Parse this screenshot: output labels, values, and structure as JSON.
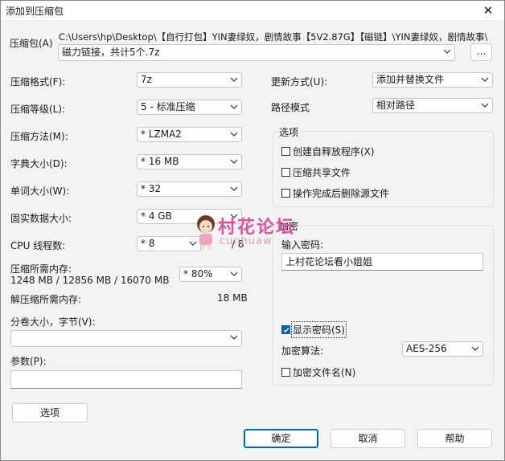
{
  "window": {
    "title": "添加到压缩包",
    "close": "✕"
  },
  "archive": {
    "label": "压缩包(A)",
    "path_line1": "C:\\Users\\hp\\Desktop\\【自行打包】YIN妻绿奴，剧情故事【5V2.87G】【磁链】\\YIN妻绿奴，剧情故事\\",
    "path_line2": "磁力链接，共计5个.7z",
    "browse": "..."
  },
  "left": {
    "format": {
      "label": "压缩格式(F):",
      "value": "7z"
    },
    "level": {
      "label": "压缩等级(L):",
      "value": "5 - 标准压缩"
    },
    "method": {
      "label": "压缩方法(M):",
      "value": "*  LZMA2"
    },
    "dict": {
      "label": "字典大小(D):",
      "value": "*  16 MB"
    },
    "word": {
      "label": "单词大小(W):",
      "value": "*  32"
    },
    "solid": {
      "label": "固实数据大小:",
      "value": "*  4 GB"
    },
    "cpu": {
      "label": "CPU 线程数:",
      "value": "*  8",
      "suffix": "/ 8"
    },
    "mem": {
      "label": "压缩所需内存:",
      "detail": "1248 MB / 12856 MB / 16070 MB",
      "value": "*  80%"
    },
    "decomp": {
      "label": "解压缩所需内存:",
      "value": "18 MB"
    },
    "split": {
      "label": "分卷大小，字节(V):",
      "value": ""
    },
    "params": {
      "label": "参数(P):",
      "value": ""
    },
    "options_btn": "选项"
  },
  "right": {
    "update": {
      "label": "更新方式(U):",
      "value": "添加并替换文件"
    },
    "pathmode": {
      "label": "路径模式",
      "value": "相对路径"
    },
    "options_group": {
      "title": "选项",
      "sfx": "创建自释放程序(X)",
      "shared": "压缩共享文件",
      "delete": "操作完成后删除源文件"
    },
    "encrypt_group": {
      "title": "加密",
      "pw_label": "输入密码:",
      "pw_value": "上村花论坛看小姐姐",
      "show_pw": "显示密码(S)",
      "algo_label": "加密算法:",
      "algo_value": "AES-256",
      "enc_names": "加密文件名(N)"
    }
  },
  "buttons": {
    "ok": "确定",
    "cancel": "取消",
    "help": "帮助"
  },
  "watermark": {
    "text": "村花论坛",
    "sub": "cunhuaw"
  },
  "checks": {
    "sfx": false,
    "shared": false,
    "delete": false,
    "show_pw": true,
    "enc_names": false
  }
}
